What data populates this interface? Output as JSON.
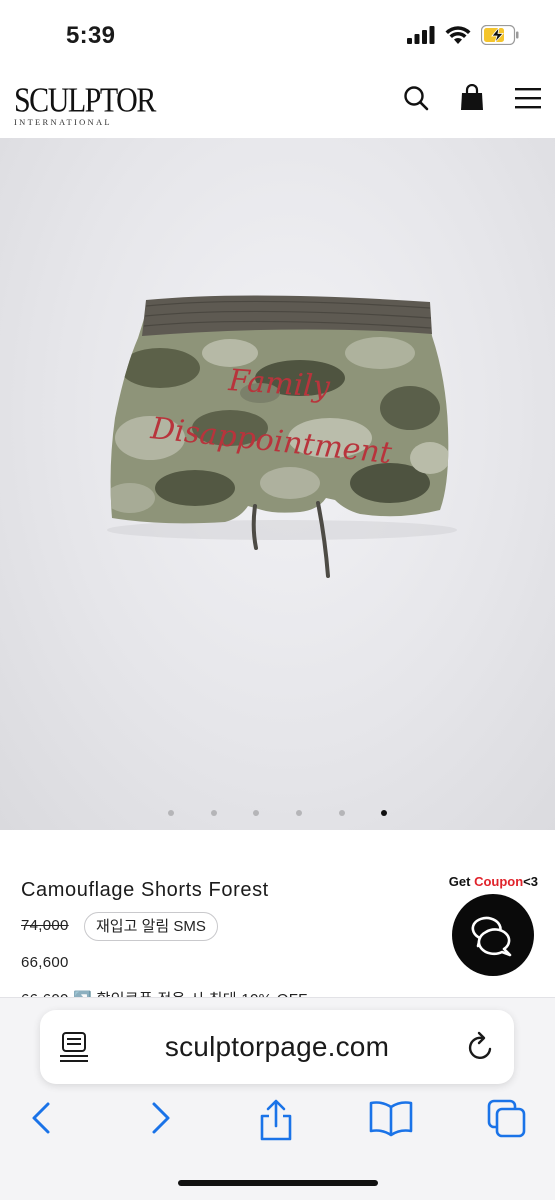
{
  "status_bar": {
    "time": "5:39",
    "icons": [
      "cellular-signal-icon",
      "wifi-icon",
      "battery-charging-icon"
    ]
  },
  "header": {
    "logo_main": "SCULPTOR",
    "logo_sub": "INTERNATIONAL",
    "icons": [
      "search-icon",
      "shopping-bag-icon",
      "menu-icon"
    ]
  },
  "gallery": {
    "image": "camouflage-shorts-photo",
    "dot_count": 6,
    "active_index": 5
  },
  "product": {
    "title": "Camouflage Shorts Forest",
    "original_price": "74,000",
    "restock_label": "재입고 알림 SMS",
    "sale_price": "66,600",
    "coupon_text": "66,600 ↗️ 할인쿠폰 적용 시 최대 10% OFF"
  },
  "coupon_badge": {
    "prefix": "Get ",
    "highlight": "Coupon",
    "suffix": "<3"
  },
  "safari": {
    "address": "sculptorpage.com",
    "toolbar_icons": [
      "back-icon",
      "forward-icon",
      "share-icon",
      "bookmarks-icon",
      "tabs-icon"
    ]
  },
  "colors": {
    "accent_red": "#e0232b",
    "ios_blue": "#1a73e8",
    "camo_dark": "#5a5f4a",
    "embroidery_red": "#b8343c"
  }
}
